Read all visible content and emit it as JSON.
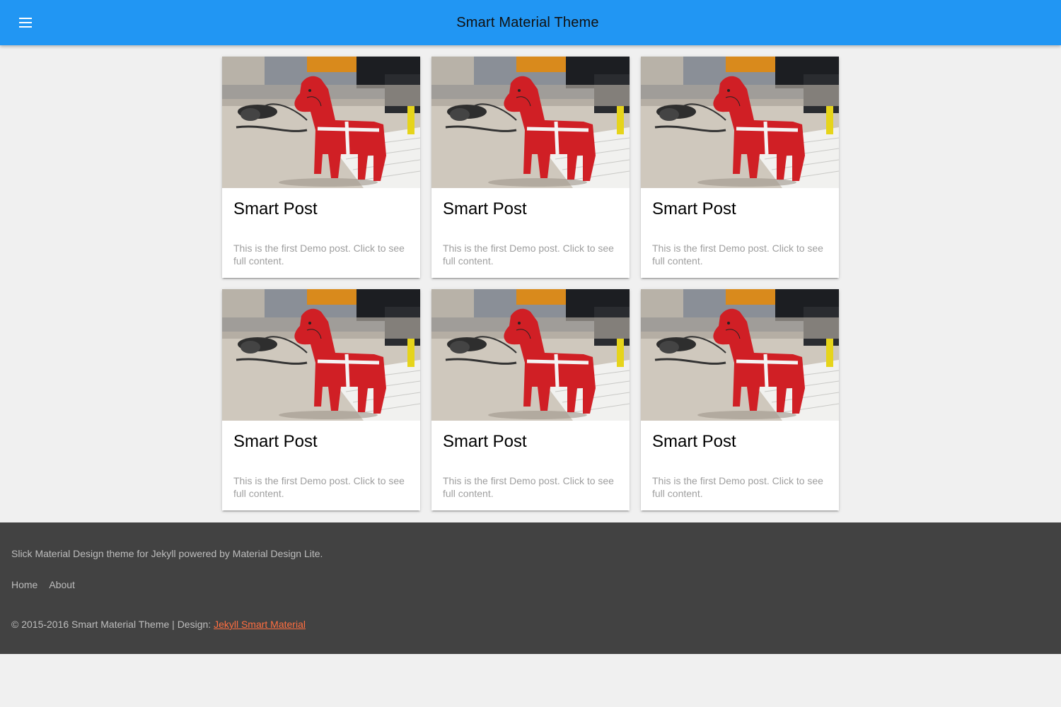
{
  "header": {
    "title": "Smart Material Theme",
    "menu_icon": "menu-icon",
    "color": "#2196f3"
  },
  "posts": [
    {
      "title": "Smart Post",
      "excerpt": "This is the first Demo post. Click to see full content."
    },
    {
      "title": "Smart Post",
      "excerpt": "This is the first Demo post. Click to see full content."
    },
    {
      "title": "Smart Post",
      "excerpt": "This is the first Demo post. Click to see full content."
    },
    {
      "title": "Smart Post",
      "excerpt": "This is the first Demo post. Click to see full content."
    },
    {
      "title": "Smart Post",
      "excerpt": "This is the first Demo post. Click to see full content."
    },
    {
      "title": "Smart Post",
      "excerpt": "This is the first Demo post. Click to see full content."
    }
  ],
  "footer": {
    "description": "Slick Material Design theme for Jekyll powered by Material Design Lite.",
    "links": [
      "Home",
      "About"
    ],
    "copyright": "© 2015-2016 Smart Material Theme | Design: ",
    "design_link": "Jekyll Smart Material",
    "background": "#424242",
    "link_color": "#ff6e40"
  }
}
